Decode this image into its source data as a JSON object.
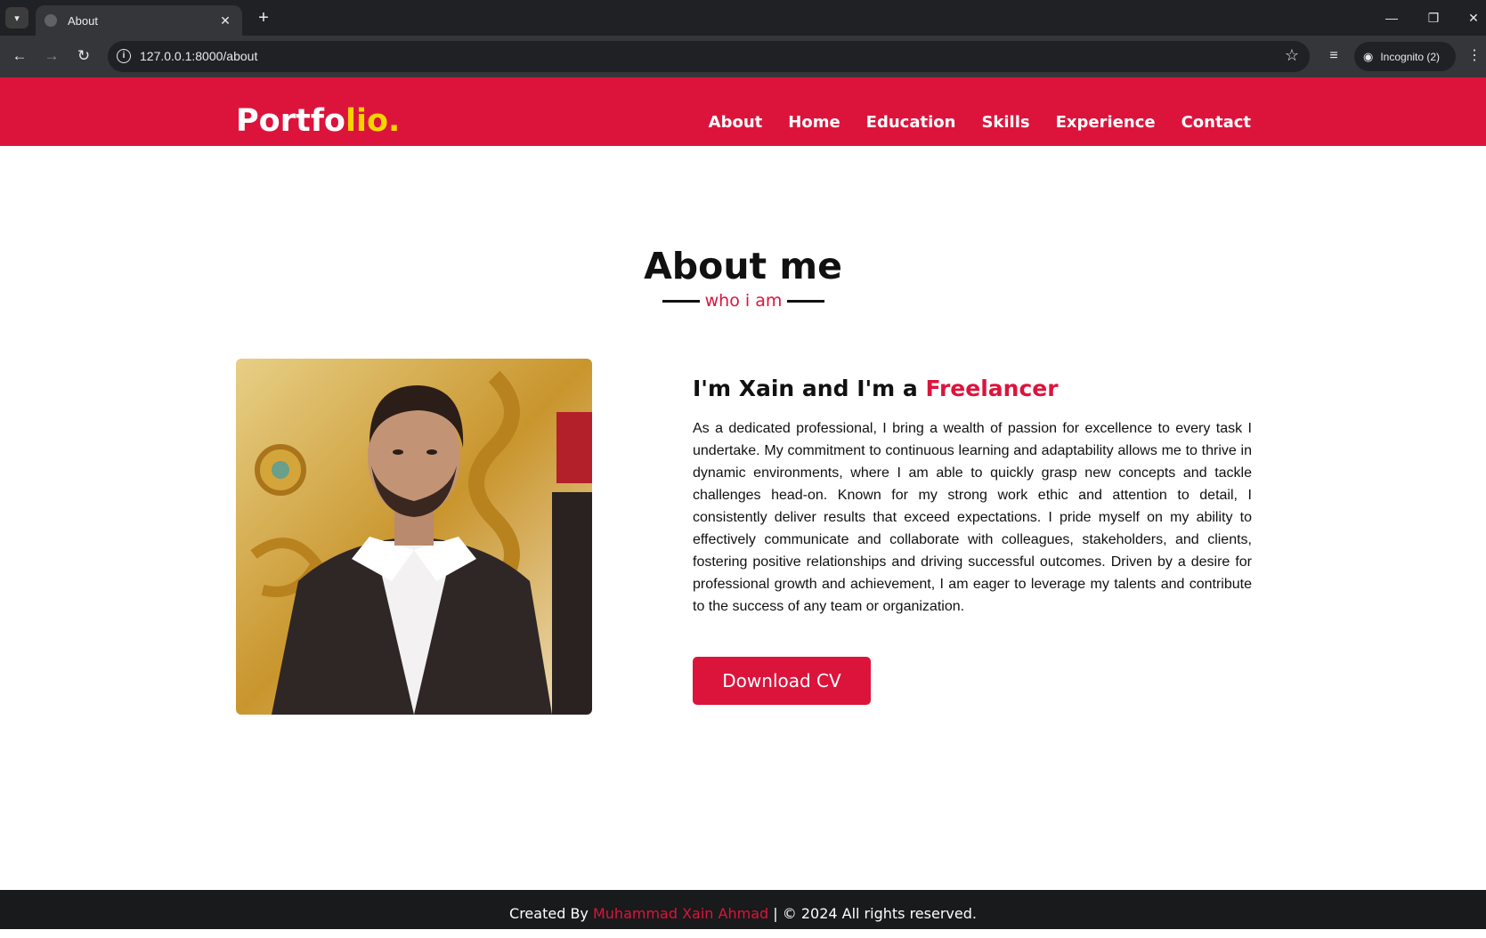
{
  "browser": {
    "tab_title": "About",
    "url": "127.0.0.1:8000/about",
    "incognito_label": "Incognito (2)"
  },
  "nav": {
    "logo_main": "Portfo",
    "logo_accent": "lio.",
    "links": [
      "About",
      "Home",
      "Education",
      "Skills",
      "Experience",
      "Contact"
    ]
  },
  "about": {
    "title": "About me",
    "subtitle": "who i am",
    "heading_prefix": "I'm Xain and I'm a",
    "heading_accent": "Freelancer",
    "paragraph": "As a dedicated professional, I bring a wealth of passion for excellence to every task I undertake. My commitment to continuous learning and adaptability allows me to thrive in dynamic environments, where I am able to quickly grasp new concepts and tackle challenges head-on. Known for my strong work ethic and attention to detail, I consistently deliver results that exceed expectations. I pride myself on my ability to effectively communicate and collaborate with colleagues, stakeholders, and clients, fostering positive relationships and driving successful outcomes. Driven by a desire for professional growth and achievement, I am eager to leverage my talents and contribute to the success of any team or organization.",
    "cv_button": "Download CV"
  },
  "footer": {
    "prefix": "Created By",
    "author": "Muhammad Xain Ahmad",
    "suffix": "| © 2024 All rights reserved."
  },
  "colors": {
    "brand": "#dc143c",
    "logo_accent": "#f5d400",
    "footer_bg": "#181a1b"
  }
}
